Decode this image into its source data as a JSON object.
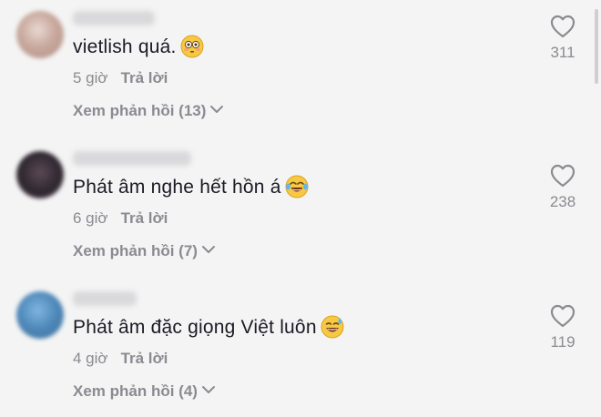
{
  "comments": [
    {
      "text": "vietlish quá.",
      "emoji": "flushed-face-emoji",
      "time": "5 giờ",
      "reply_label": "Trả lời",
      "view_replies": "Xem phản hồi (13)",
      "likes": "311"
    },
    {
      "text": "Phát âm nghe hết hồn á",
      "emoji": "laughing-tears-emoji",
      "time": "6 giờ",
      "reply_label": "Trả lời",
      "view_replies": "Xem phản hồi (7)",
      "likes": "238"
    },
    {
      "text": "Phát âm đặc giọng Việt luôn",
      "emoji": "grinning-sweat-emoji",
      "time": "4 giờ",
      "reply_label": "Trả lời",
      "view_replies": "Xem phản hồi (4)",
      "likes": "119"
    }
  ],
  "icons": {
    "like": "heart-outline-icon",
    "expand": "chevron-down-icon"
  },
  "colors": {
    "background": "#f4f4f4",
    "text": "#161823",
    "muted": "#8a8b91"
  }
}
